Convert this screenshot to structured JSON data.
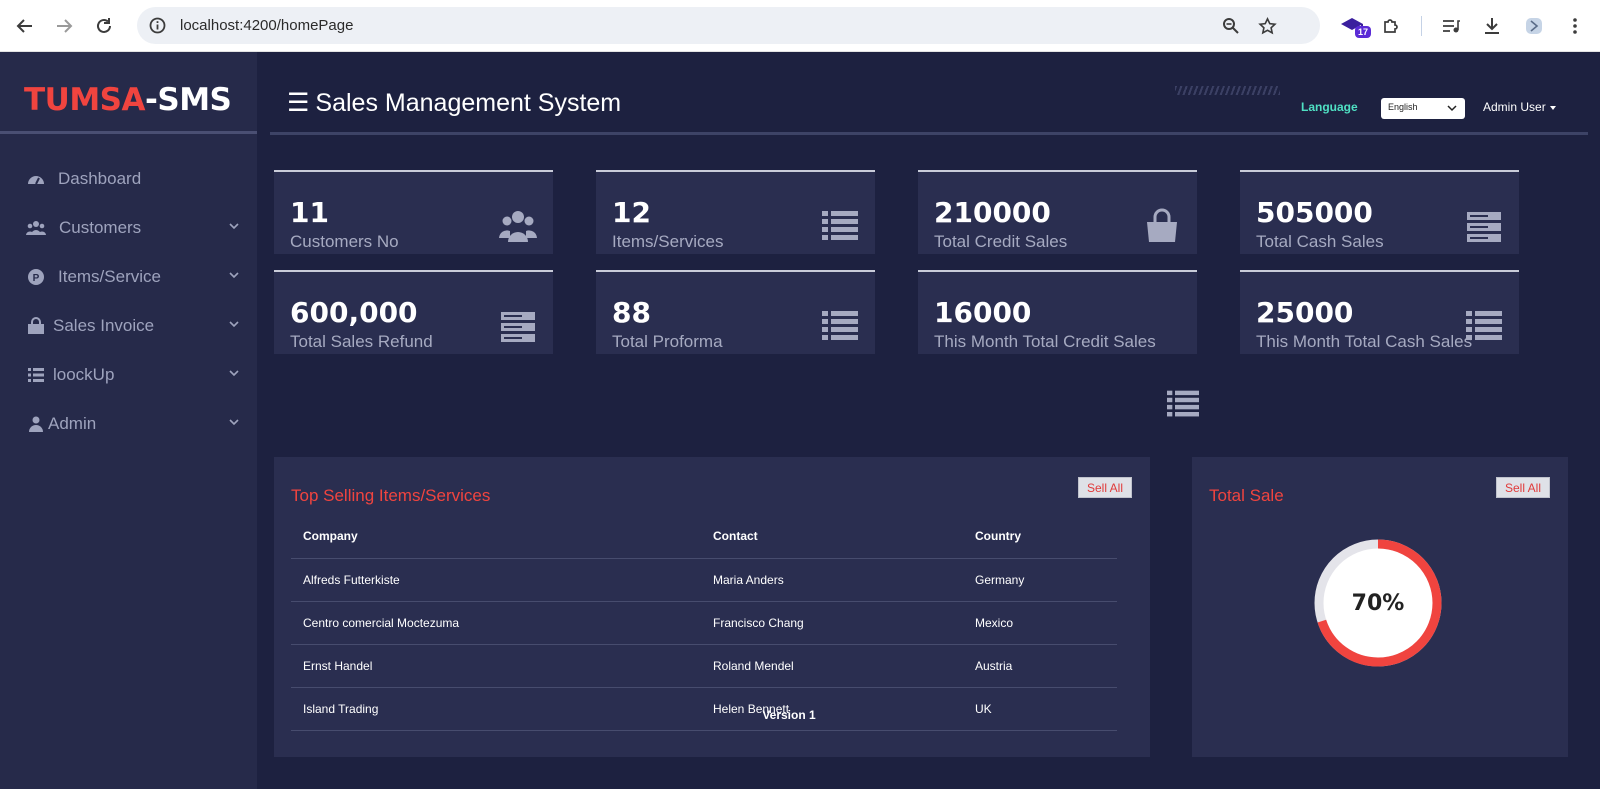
{
  "browser": {
    "url": "localhost:4200/homePage",
    "extension_badge": "17"
  },
  "sidebar": {
    "brand_red": "TUMSA",
    "brand_white": "-SMS",
    "items": [
      {
        "label": "Dashboard",
        "icon": "dashboard-icon",
        "has_children": false
      },
      {
        "label": "Customers",
        "icon": "users-icon",
        "has_children": true
      },
      {
        "label": "Items/Service",
        "icon": "product-icon",
        "has_children": true
      },
      {
        "label": "Sales Invoice",
        "icon": "shopping-bag-icon",
        "has_children": true
      },
      {
        "label": "loockUp",
        "icon": "list-icon",
        "has_children": true
      },
      {
        "label": "Admin",
        "icon": "user-icon",
        "has_children": true
      }
    ]
  },
  "header": {
    "menu_glyph": "☰",
    "title": "Sales Management System",
    "language_label": "Language",
    "language_selected": "English",
    "user_menu": "Admin User"
  },
  "stats": [
    {
      "value": "11",
      "label": "Customers No",
      "icon": "users-icon"
    },
    {
      "value": "12",
      "label": "Items/Services",
      "icon": "list-icon"
    },
    {
      "value": "210000",
      "label": "Total Credit Sales",
      "icon": "shopping-bag-icon"
    },
    {
      "value": "505000",
      "label": "Total Cash Sales",
      "icon": "server-icon"
    },
    {
      "value": "600,000",
      "label": "Total Sales Refund",
      "icon": "server-icon"
    },
    {
      "value": "88",
      "label": "Total Proforma",
      "icon": "list-icon"
    },
    {
      "value": "16000",
      "label": "This Month Total Credit Sales",
      "icon": "list-icon"
    },
    {
      "value": "25000",
      "label": "This Month Total Cash Sales",
      "icon": "list-icon"
    }
  ],
  "top_selling": {
    "title": "Top Selling Items/Services",
    "button": "Sell All",
    "columns": [
      "Company",
      "Contact",
      "Country"
    ],
    "rows": [
      [
        "Alfreds Futterkiste",
        "Maria Anders",
        "Germany"
      ],
      [
        "Centro comercial Moctezuma",
        "Francisco Chang",
        "Mexico"
      ],
      [
        "Ernst Handel",
        "Roland Mendel",
        "Austria"
      ],
      [
        "Island Trading",
        "Helen Bennett",
        "UK"
      ]
    ]
  },
  "total_sale": {
    "title": "Total Sale",
    "button": "Sell All",
    "percent_label": "70%",
    "progress": 0.7,
    "colors": {
      "fill": "#f0443f",
      "track": "#e4e4ea",
      "center": "#ffffff"
    }
  },
  "footer": {
    "version": "Version 1"
  },
  "colors": {
    "sidebar_bg": "#262a4a",
    "main_bg": "#1d2140",
    "card_bg": "#2a2e50",
    "accent_red": "#f0443f",
    "language_teal": "#4fe0c3"
  }
}
